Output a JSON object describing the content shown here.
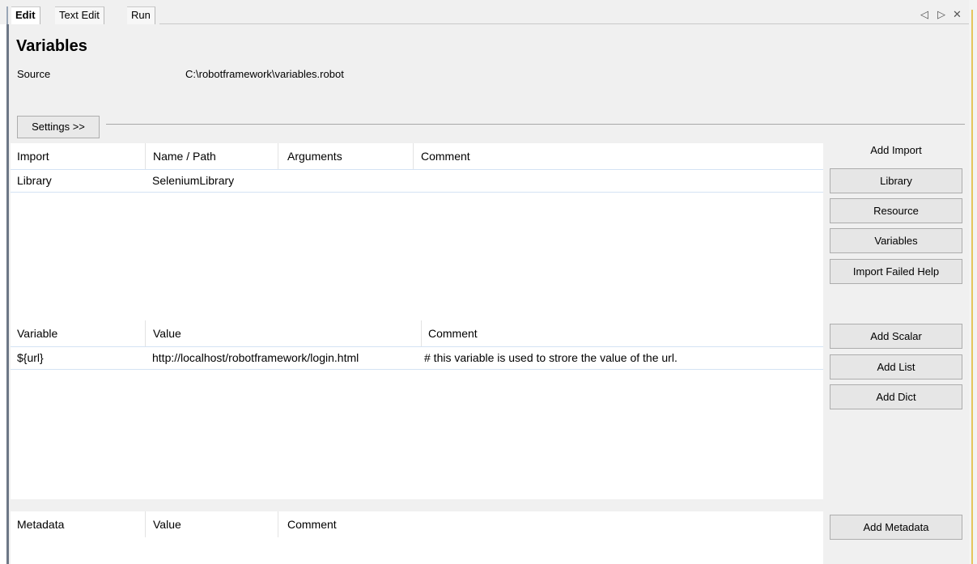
{
  "tabs": [
    {
      "label": "Edit",
      "active": true
    },
    {
      "label": "Text Edit",
      "active": false
    },
    {
      "label": "Run",
      "active": false
    }
  ],
  "window_controls": {
    "prev": "◁",
    "next": "▷",
    "close": "✕"
  },
  "page": {
    "title": "Variables",
    "source_label": "Source",
    "source_value": "C:\\robotframework\\variables.robot",
    "settings_button": "Settings >>"
  },
  "imports": {
    "headers": [
      "Import",
      "Name / Path",
      "Arguments",
      "Comment"
    ],
    "rows": [
      {
        "import": "Library",
        "name": "SeleniumLibrary",
        "arguments": "",
        "comment": ""
      }
    ],
    "panel_label": "Add Import",
    "buttons": [
      "Library",
      "Resource",
      "Variables",
      "Import Failed Help"
    ]
  },
  "variables": {
    "headers": [
      "Variable",
      "Value",
      "Comment"
    ],
    "rows": [
      {
        "variable": "${url}",
        "value": "http://localhost/robotframework/login.html",
        "comment": "# this variable is used to strore the value of the url."
      }
    ],
    "buttons": [
      "Add Scalar",
      "Add List",
      "Add Dict"
    ]
  },
  "metadata": {
    "headers": [
      "Metadata",
      "Value",
      "Comment"
    ],
    "rows": [],
    "buttons": [
      "Add Metadata"
    ]
  },
  "colors": {
    "accent_border": "#e5c55d",
    "row_border": "#d4e3f4",
    "panel_bg": "#f0f0f0"
  }
}
